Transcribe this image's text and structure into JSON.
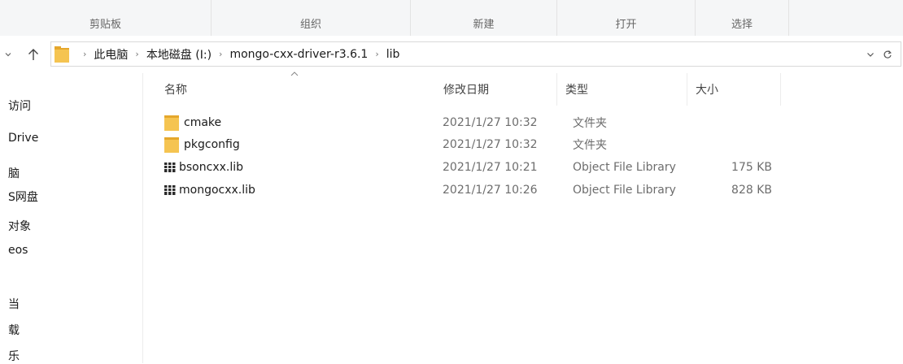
{
  "ribbon": {
    "tabs": [
      "剪贴板",
      "组织",
      "新建",
      "打开",
      "选择"
    ]
  },
  "address": {
    "crumbs": [
      "此电脑",
      "本地磁盘 (I:)",
      "mongo-cxx-driver-r3.6.1",
      "lib"
    ],
    "dropdown_icon": "chevron-down-icon",
    "refresh_icon": "refresh-icon"
  },
  "nav_pane": {
    "items": [
      "访问",
      "Drive",
      "脑",
      "S网盘",
      "对象",
      "eos",
      "​",
      "当",
      "载",
      "乐"
    ]
  },
  "columns": {
    "name": "名称",
    "modified": "修改日期",
    "type": "类型",
    "size": "大小"
  },
  "files": [
    {
      "name": "cmake",
      "modified": "2021/1/27 10:32",
      "type": "文件夹",
      "size": "",
      "icon": "folder-icon"
    },
    {
      "name": "pkgconfig",
      "modified": "2021/1/27 10:32",
      "type": "文件夹",
      "size": "",
      "icon": "folder-icon"
    },
    {
      "name": "bsoncxx.lib",
      "modified": "2021/1/27 10:21",
      "type": "Object File Library",
      "size": "175 KB",
      "icon": "library-file-icon"
    },
    {
      "name": "mongocxx.lib",
      "modified": "2021/1/27 10:26",
      "type": "Object File Library",
      "size": "828 KB",
      "icon": "library-file-icon"
    }
  ],
  "colors": {
    "folder": "#f5c451",
    "folder_dark": "#e5a72c"
  }
}
